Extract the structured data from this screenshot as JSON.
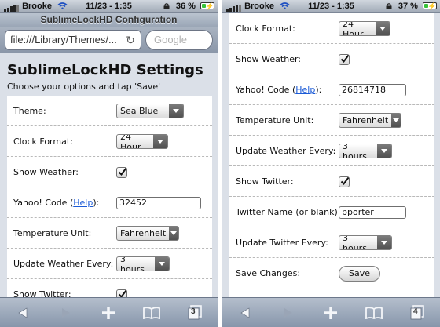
{
  "left": {
    "status": {
      "carrier": "Brooke",
      "time": "11/23 - 1:35",
      "battery": "36 %",
      "battery_level": 0.36
    },
    "browser": {
      "page_title": "SublimeLockHD Configuration",
      "url": "file:///Library/Themes/...",
      "search_placeholder": "Google",
      "tab_count": "3"
    },
    "page": {
      "title": "SublimeLockHD Settings",
      "subtitle": "Choose your options and tap 'Save'"
    },
    "settings": {
      "theme": {
        "label": "Theme:",
        "value": "Sea Blue"
      },
      "clock_format": {
        "label": "Clock Format:",
        "value": "24 Hour"
      },
      "show_weather": {
        "label": "Show Weather:",
        "checked": true
      },
      "yahoo_code": {
        "label_prefix": "Yahoo! Code (",
        "link": "Help",
        "label_suffix": "):",
        "value": "32452"
      },
      "temperature_unit": {
        "label": "Temperature Unit:",
        "value": "Fahrenheit"
      },
      "update_weather": {
        "label": "Update Weather Every:",
        "value": "3 hours"
      },
      "show_twitter": {
        "label": "Show Twitter:",
        "checked": true
      }
    }
  },
  "right": {
    "status": {
      "carrier": "Brooke",
      "time": "11/23 - 1:35",
      "battery": "37 %",
      "battery_level": 0.37
    },
    "browser": {
      "tab_count": "4"
    },
    "settings": {
      "clock_format": {
        "label": "Clock Format:",
        "value": "24 Hour"
      },
      "show_weather": {
        "label": "Show Weather:",
        "checked": true
      },
      "yahoo_code": {
        "label_prefix": "Yahoo! Code (",
        "link": "Help",
        "label_suffix": "):",
        "value": "26814718"
      },
      "temperature_unit": {
        "label": "Temperature Unit:",
        "value": "Fahrenheit"
      },
      "update_weather": {
        "label": "Update Weather Every:",
        "value": "3 hours"
      },
      "show_twitter": {
        "label": "Show Twitter:",
        "checked": true
      },
      "twitter_name": {
        "label": "Twitter Name (or blank):",
        "value": "bporter"
      },
      "update_twitter": {
        "label": "Update Twitter Every:",
        "value": "3 hours"
      },
      "save": {
        "label": "Save Changes:",
        "button": "Save"
      }
    }
  },
  "icons": {
    "wifi": "wifi-icon",
    "lock": "lock-icon",
    "battery": "battery-icon",
    "reload": "reload-icon",
    "back": "back-arrow-icon",
    "forward": "forward-arrow-icon",
    "add": "add-icon",
    "bookmarks": "bookmarks-icon",
    "pages": "pages-icon",
    "check": "checkmark-icon"
  },
  "colors": {
    "link": "#1a5ad6",
    "charging": "#38c23a",
    "toolbar": "#8796ab"
  }
}
